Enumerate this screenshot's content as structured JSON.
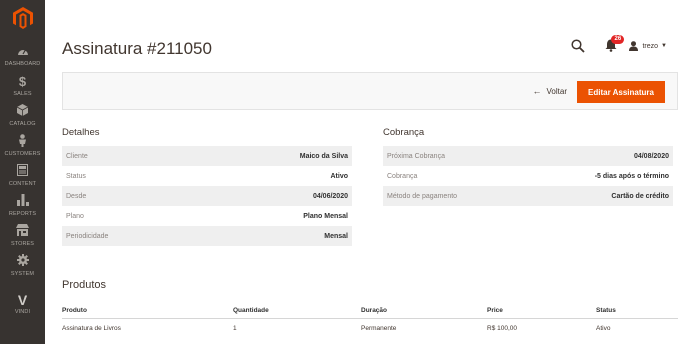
{
  "sidebar": {
    "items": [
      {
        "label": "DASHBOARD",
        "icon": "gauge-icon"
      },
      {
        "label": "SALES",
        "icon": "dollar-icon"
      },
      {
        "label": "CATALOG",
        "icon": "cube-icon"
      },
      {
        "label": "CUSTOMERS",
        "icon": "person-icon"
      },
      {
        "label": "CONTENT",
        "icon": "content-icon"
      },
      {
        "label": "REPORTS",
        "icon": "bar-chart-icon"
      },
      {
        "label": "STORES",
        "icon": "store-icon"
      },
      {
        "label": "SYSTEM",
        "icon": "gear-icon"
      },
      {
        "label": "VINDI",
        "icon": "vindi-logo-icon"
      }
    ]
  },
  "header": {
    "title": "Assinatura #211050",
    "notifications_count": "26",
    "user_name": "trezo"
  },
  "actions": {
    "back_label": "Voltar",
    "edit_label": "Editar Assinatura"
  },
  "details": {
    "title": "Detalhes",
    "rows": [
      {
        "key": "Cliente",
        "value": "Maico da Silva"
      },
      {
        "key": "Status",
        "value": "Ativo"
      },
      {
        "key": "Desde",
        "value": "04/06/2020"
      },
      {
        "key": "Plano",
        "value": "Plano Mensal"
      },
      {
        "key": "Periodicidade",
        "value": "Mensal"
      }
    ]
  },
  "billing": {
    "title": "Cobrança",
    "rows": [
      {
        "key": "Próxima Cobrança",
        "value": "04/08/2020"
      },
      {
        "key": "Cobrança",
        "value": "-5 dias após o término"
      },
      {
        "key": "Método de pagamento",
        "value": "Cartão de crédito"
      }
    ]
  },
  "products": {
    "title": "Produtos",
    "columns": [
      "Produto",
      "Quantidade",
      "Duração",
      "Price",
      "Status"
    ],
    "rows": [
      [
        "Assinatura de Livros",
        "1",
        "Permanente",
        "R$ 100,00",
        "Ativo"
      ]
    ]
  },
  "colors": {
    "sidebar_bg": "#373330",
    "accent": "#eb5202",
    "badge": "#e22626"
  }
}
